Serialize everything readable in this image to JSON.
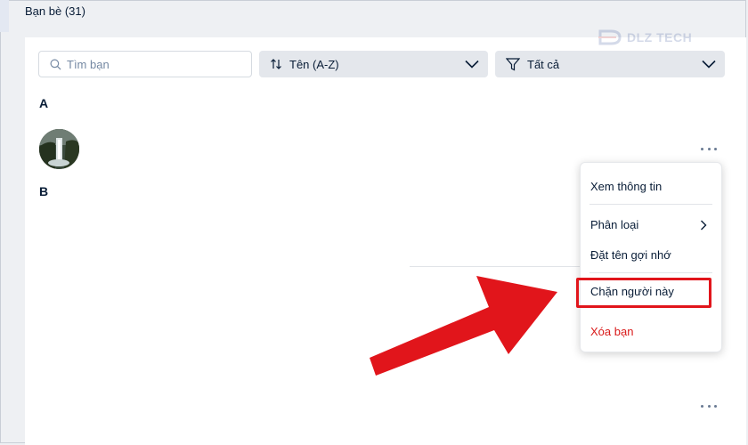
{
  "header": {
    "title": "Bạn bè (31)"
  },
  "watermark": {
    "text": "DLZ TECH"
  },
  "toolbar": {
    "search_placeholder": "Tìm bạn",
    "sort_label": "Tên (A-Z)",
    "filter_label": "Tất cả"
  },
  "groups": [
    {
      "letter": "A"
    },
    {
      "letter": "B"
    }
  ],
  "context_menu": {
    "items": [
      {
        "label": "Xem thông tin"
      },
      {
        "label": "Phân loại"
      },
      {
        "label": "Đặt tên gợi nhớ"
      },
      {
        "label": "Chặn người này"
      },
      {
        "label": "Xóa bạn"
      }
    ]
  },
  "colors": {
    "accent_highlight": "#e1151b",
    "danger_text": "#d91b1b",
    "background": "#eef0f3"
  },
  "icons": [
    "search-icon",
    "sort-icon",
    "filter-icon",
    "chevron-down-icon",
    "more-icon",
    "chevron-right-icon"
  ]
}
